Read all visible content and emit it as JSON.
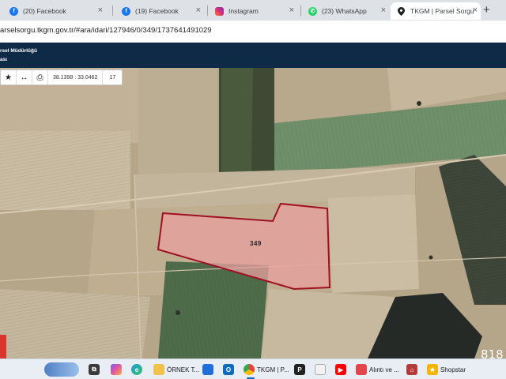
{
  "browser": {
    "tabs": [
      {
        "label": "(20) Facebook",
        "icon": "facebook-icon",
        "close": "×"
      },
      {
        "label": "(19) Facebook",
        "icon": "facebook-icon",
        "close": "×"
      },
      {
        "label": "Instagram",
        "icon": "instagram-icon",
        "close": "×"
      },
      {
        "label": "(23) WhatsApp",
        "icon": "whatsapp-icon",
        "close": "×"
      },
      {
        "label": "TKGM | Parsel Sorgu",
        "icon": "map-pin-icon",
        "close": "×",
        "active": true
      }
    ],
    "new_tab": "+",
    "url": "arselsorgu.tkgm.gov.tr/#ara/idari/127946/0/349/1737641491029"
  },
  "site": {
    "title_line1": "rsel Müdürlüğü",
    "title_line2": "ası"
  },
  "map_toolbar": {
    "star_icon": "★",
    "measure_icon": "↔",
    "print_icon": "⎙",
    "coordinates": "38.1398 : 33.0462",
    "zoom": "17"
  },
  "map": {
    "parcel_number": "349",
    "corner_number": "818",
    "parcel_color": "#e8a0a0",
    "parcel_border": "#a01020"
  },
  "taskbar": {
    "items": [
      {
        "label": "",
        "icon": "weather-icon"
      },
      {
        "label": "",
        "icon": "task-view-icon"
      },
      {
        "label": "",
        "icon": "copilot-icon"
      },
      {
        "label": "",
        "icon": "edge-icon"
      },
      {
        "label": "ÖRNEK T...",
        "icon": "folder-icon"
      },
      {
        "label": "",
        "icon": "store-icon"
      },
      {
        "label": "",
        "icon": "outlook-icon"
      },
      {
        "label": "TKGM | P...",
        "icon": "chrome-icon"
      },
      {
        "label": "P",
        "icon": "app-icon"
      },
      {
        "label": "",
        "icon": "app-icon-2"
      },
      {
        "label": "",
        "icon": "youtube-icon"
      },
      {
        "label": "Alıntı ve ...",
        "icon": "snipping-tool-icon"
      },
      {
        "label": "",
        "icon": "home-icon"
      },
      {
        "label": "Shopstar",
        "icon": "shopstar-icon"
      }
    ]
  }
}
